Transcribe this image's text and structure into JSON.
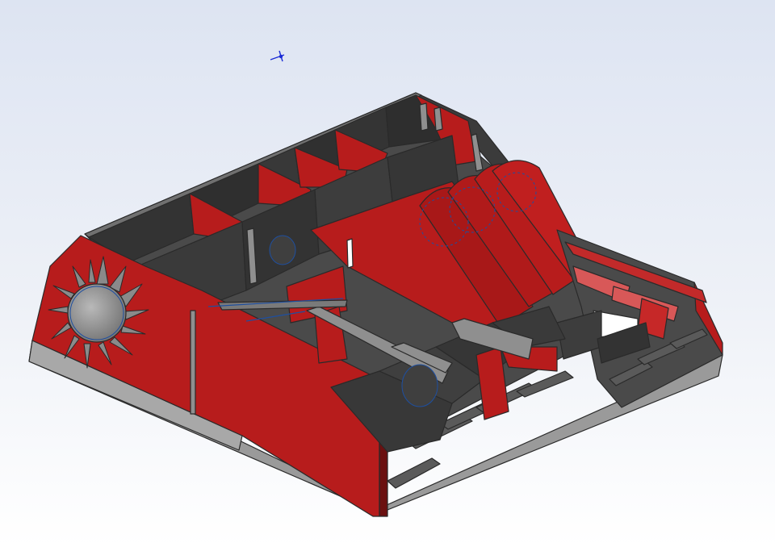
{
  "viewport": {
    "background_top": "#dde4f2",
    "background_bottom": "#ffffff"
  },
  "model": {
    "plate_color": "#b71c1c",
    "plate_edge_color": "#2a2a2a",
    "interior_color": "#3a3a3a",
    "steel_color": "#8f8f8f",
    "sketch_color": "#1e4fa0"
  },
  "triad": {
    "icon": "coordinate-triad-icon",
    "color": "#1a2bd6"
  }
}
